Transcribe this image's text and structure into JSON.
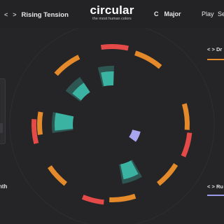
{
  "header": {
    "preset_prev": "<",
    "preset_next": ">",
    "preset_name": "Rising Tension",
    "brand_title": "circular",
    "brand_subtitle": "the most human colors",
    "key_root": "C",
    "key_mode": "Major",
    "play_label": "Play",
    "settings_label": "Se"
  },
  "left_panel": {
    "label": "nth"
  },
  "right_panel": {
    "card1": {
      "chevrons": "< >",
      "label": "Dr",
      "accent": "#e58a2b"
    },
    "card2": {
      "chevrons": "< >",
      "label": "Ru",
      "accent": "#9c9be8"
    }
  },
  "colors": {
    "background": "#252527",
    "red": "#e44a47",
    "orange": "#e58a2b",
    "teal": "#3bb3a2",
    "lavender": "#a9a6f0"
  }
}
